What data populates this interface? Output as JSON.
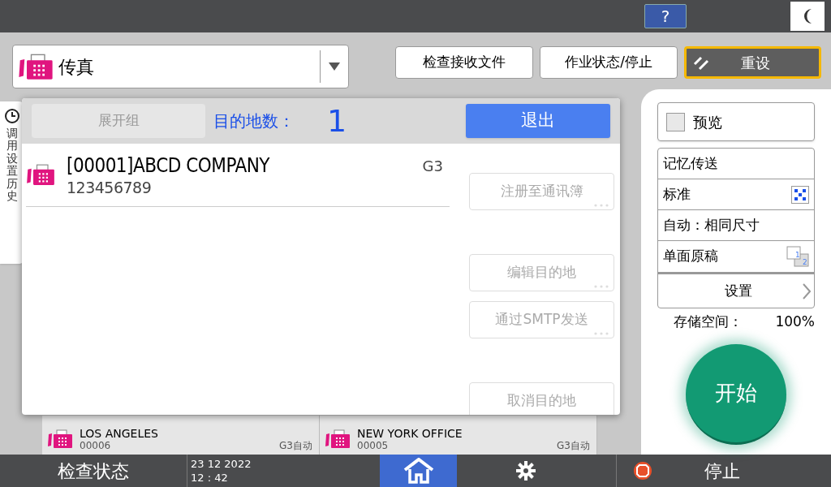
{
  "top_bar": {
    "help": "?"
  },
  "function_selector": {
    "label": "传真"
  },
  "header_buttons": [
    {
      "label": "检查接收文件",
      "kind": "normal"
    },
    {
      "label": "作业状态/停止",
      "kind": "normal"
    },
    {
      "label": "重设",
      "kind": "reset"
    }
  ],
  "side_tab": {
    "label": "调用设置历史"
  },
  "background_destinations": [
    {
      "name": "LOS ANGELES",
      "number": "00006",
      "mode": "G3自动"
    },
    {
      "name": "NEW YORK OFFICE",
      "number": "00005",
      "mode": "G3自动"
    }
  ],
  "dialog": {
    "expand_group": {
      "label": "展开组",
      "disabled": true
    },
    "count_label": "目的地数：",
    "count": "1",
    "exit": "退出",
    "destinations": [
      {
        "name": "[00001]ABCD COMPANY",
        "number": "123456789",
        "line": "G3"
      }
    ],
    "actions": [
      {
        "label": "注册至通讯簿",
        "disabled": true,
        "more": true
      },
      {
        "label": "编辑目的地",
        "disabled": true,
        "more": true
      },
      {
        "label": "通过SMTP发送",
        "disabled": true,
        "more": true
      },
      {
        "label": "取消目的地",
        "disabled": true,
        "more": false
      }
    ]
  },
  "settings_panel": {
    "preview": {
      "label": "预览",
      "checked": false
    },
    "options": [
      {
        "label": "记忆传送",
        "kind": "text"
      },
      {
        "label": "标准",
        "kind": "resolution"
      },
      {
        "label": "自动：相同尺寸",
        "kind": "text"
      },
      {
        "label": "单面原稿",
        "kind": "duplex",
        "icon_texts": [
          "1",
          "2"
        ]
      }
    ],
    "settings_button": "设置",
    "storage_label": "存储空间：",
    "storage_value": "100%",
    "start": "开始"
  },
  "bottom_bar": {
    "check_status": "检查状态",
    "date": "23 12 2022",
    "time": "12 : 42",
    "home_selected": true,
    "stop": "停止"
  }
}
